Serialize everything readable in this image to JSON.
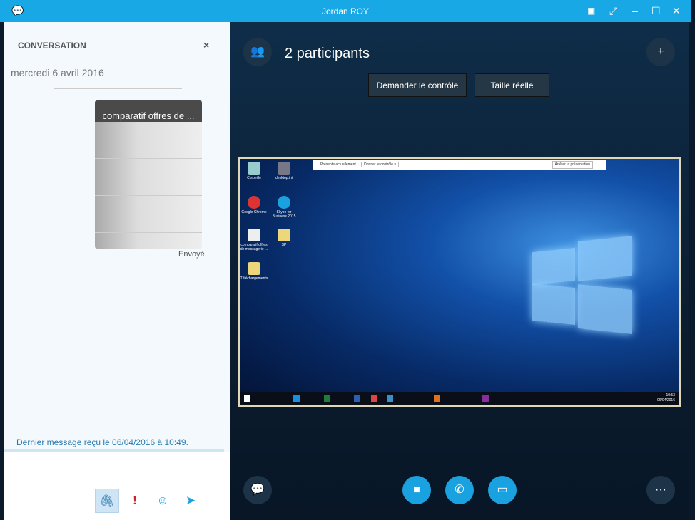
{
  "window": {
    "title": "Jordan ROY",
    "icons": [
      "skype-chat-icon",
      "layout-icon",
      "fullscreen-icon",
      "minimize-icon",
      "maximize-icon",
      "close-icon"
    ]
  },
  "conversation": {
    "header": "CONVERSATION",
    "close": "×",
    "date": "mercredi 6 avril 2016",
    "attachment_name": "comparatif offres de ...",
    "status": "Envoyé",
    "last_message": "Dernier message reçu le 06/04/2016 à 10:49."
  },
  "compose": {
    "attach_icon": "paperclip-icon",
    "priority": "!",
    "emoji": "☺",
    "send_icon": "send-icon"
  },
  "meeting": {
    "participants": "2 participants",
    "request_control": "Demander le contrôle",
    "actual_size": "Taille réelle"
  },
  "shared_screen": {
    "presenting": "Présente actuellement",
    "give_control": "Donner le contrôle ▾",
    "stop": "Arrêter la présentation",
    "desktop_icons": [
      "Corbeille",
      "desktop.ini",
      "Google Chrome",
      "Skype for Business 2015",
      "comparatif offres de messagerie ...",
      "SP",
      "Téléchargements"
    ],
    "clock_time": "10:53",
    "clock_date": "06/04/2016"
  },
  "controls": [
    "chat-icon",
    "video-icon",
    "phone-icon",
    "present-icon",
    "more-icon"
  ],
  "colors": {
    "accent": "#19a8e6",
    "background": "#0f2d49"
  }
}
